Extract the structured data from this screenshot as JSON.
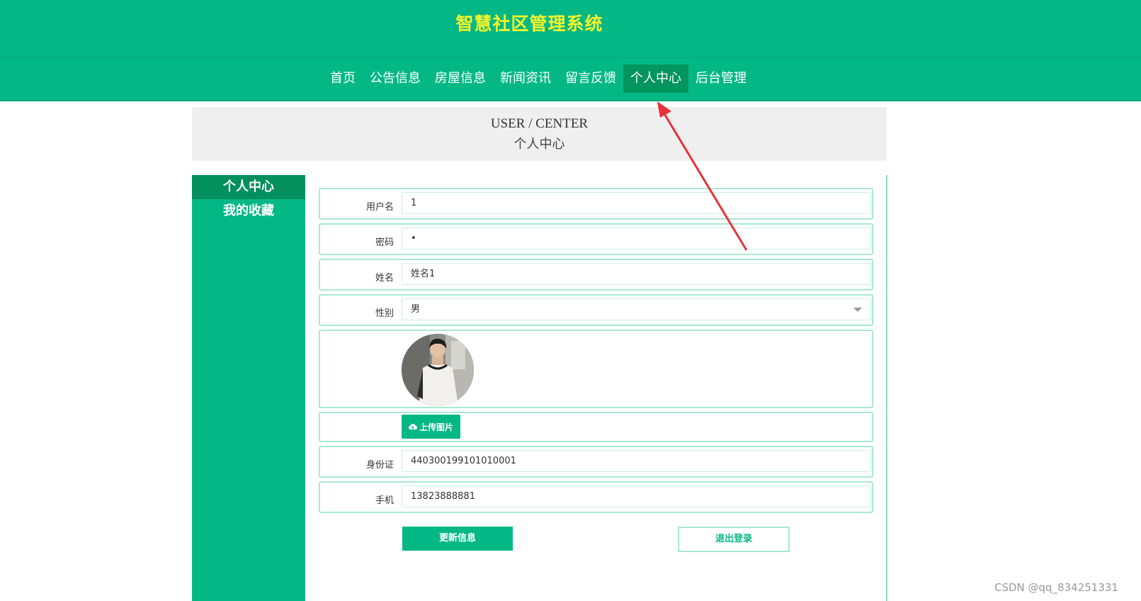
{
  "header": {
    "title": "智慧社区管理系统"
  },
  "nav": {
    "items": [
      {
        "label": "首页"
      },
      {
        "label": "公告信息"
      },
      {
        "label": "房屋信息"
      },
      {
        "label": "新闻资讯"
      },
      {
        "label": "留言反馈"
      },
      {
        "label": "个人中心",
        "active": true
      },
      {
        "label": "后台管理"
      }
    ]
  },
  "banner": {
    "en": "USER / CENTER",
    "cn": "个人中心"
  },
  "sidebar": {
    "items": [
      {
        "label": "个人中心",
        "active": true
      },
      {
        "label": "我的收藏"
      }
    ]
  },
  "form": {
    "username": {
      "label": "用户名",
      "value": "1"
    },
    "password": {
      "label": "密码",
      "value": "•"
    },
    "name": {
      "label": "姓名",
      "value": "姓名1"
    },
    "gender": {
      "label": "性别",
      "value": "男"
    },
    "upload": {
      "label": "上传图片"
    },
    "idcard": {
      "label": "身份证",
      "value": "440300199101010001"
    },
    "phone": {
      "label": "手机",
      "value": "13823888881"
    }
  },
  "actions": {
    "update": "更新信息",
    "logout": "退出登录"
  },
  "watermark": "CSDN @qq_834251331",
  "colors": {
    "primary": "#04b886",
    "title": "#f5f52a",
    "active": "#03955f",
    "annotation": "#e8313a"
  }
}
